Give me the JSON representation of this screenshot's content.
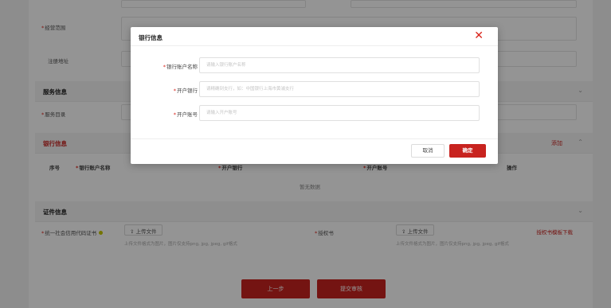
{
  "form": {
    "top_label_1": "",
    "business_scope_label": "经营范围",
    "reg_address_label": "注册地址",
    "service_section_title": "服务信息",
    "service_scope_label": "服务目录",
    "bank_section_title": "银行信息",
    "bank_add_link": "添加",
    "bank_table_headers": [
      "序号",
      "银行账户名称",
      "开户银行",
      "开户账号",
      "操作"
    ],
    "bank_empty_text": "暂无数据",
    "cert_section_title": "证件信息",
    "credit_code_label": "统一社会信用代码证书",
    "upload_label": "上传文件",
    "upload_hint": "上传文件格式为图片，图片仅支持png, jpg, jpeg, gif格式",
    "auth_letter_label": "授权书",
    "auth_template_link": "授权书模板下载",
    "prev_button": "上一步",
    "submit_button": "提交审核"
  },
  "modal": {
    "title": "银行信息",
    "close_icon": "close-icon",
    "fields": [
      {
        "label": "银行账户名称",
        "placeholder": "请输入银行账户名称"
      },
      {
        "label": "开户银行",
        "placeholder": "请精确到支行，如：中国银行上海市黄浦支行"
      },
      {
        "label": "开户账号",
        "placeholder": "请输入开户账号"
      }
    ],
    "cancel_label": "取消",
    "ok_label": "确定"
  },
  "colors": {
    "accent_red": "#c8231f",
    "overlay": "rgba(0,0,0,0.42)"
  }
}
